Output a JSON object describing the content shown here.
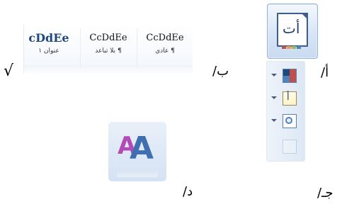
{
  "question": {
    "options": [
      {
        "letter": "أ/"
      },
      {
        "letter": "ب/"
      },
      {
        "letter": "جـ/"
      },
      {
        "letter": "د/"
      }
    ],
    "checkmark": "√"
  },
  "option_a": {
    "icon_glyph": "أت",
    "strip_colors": [
      "#c0504d",
      "#f79646",
      "#9bbb59",
      "#4f81bd",
      "#8064a2"
    ]
  },
  "option_b": {
    "styles": [
      {
        "sample": "CcDdEe",
        "name": "¶ عادي"
      },
      {
        "sample": "CcDdEe",
        "name": "¶ بلا تباعد"
      },
      {
        "sample": "cDdEe",
        "name": "عنوان ١"
      }
    ]
  },
  "option_c": {
    "buttons": [
      {
        "icon": "color-palette-icon",
        "colors": [
          "#c0504d",
          "#1f497d",
          "#4f81bd",
          "#ffffff"
        ]
      },
      {
        "icon": "font-glyph-icon",
        "glyph": "أ"
      },
      {
        "icon": "effects-circle-icon"
      }
    ]
  },
  "option_d": {
    "icon": "grow-font-icon",
    "glyph": "A",
    "back_color": "#b14bb5",
    "front_color": "#3f6fb0"
  }
}
